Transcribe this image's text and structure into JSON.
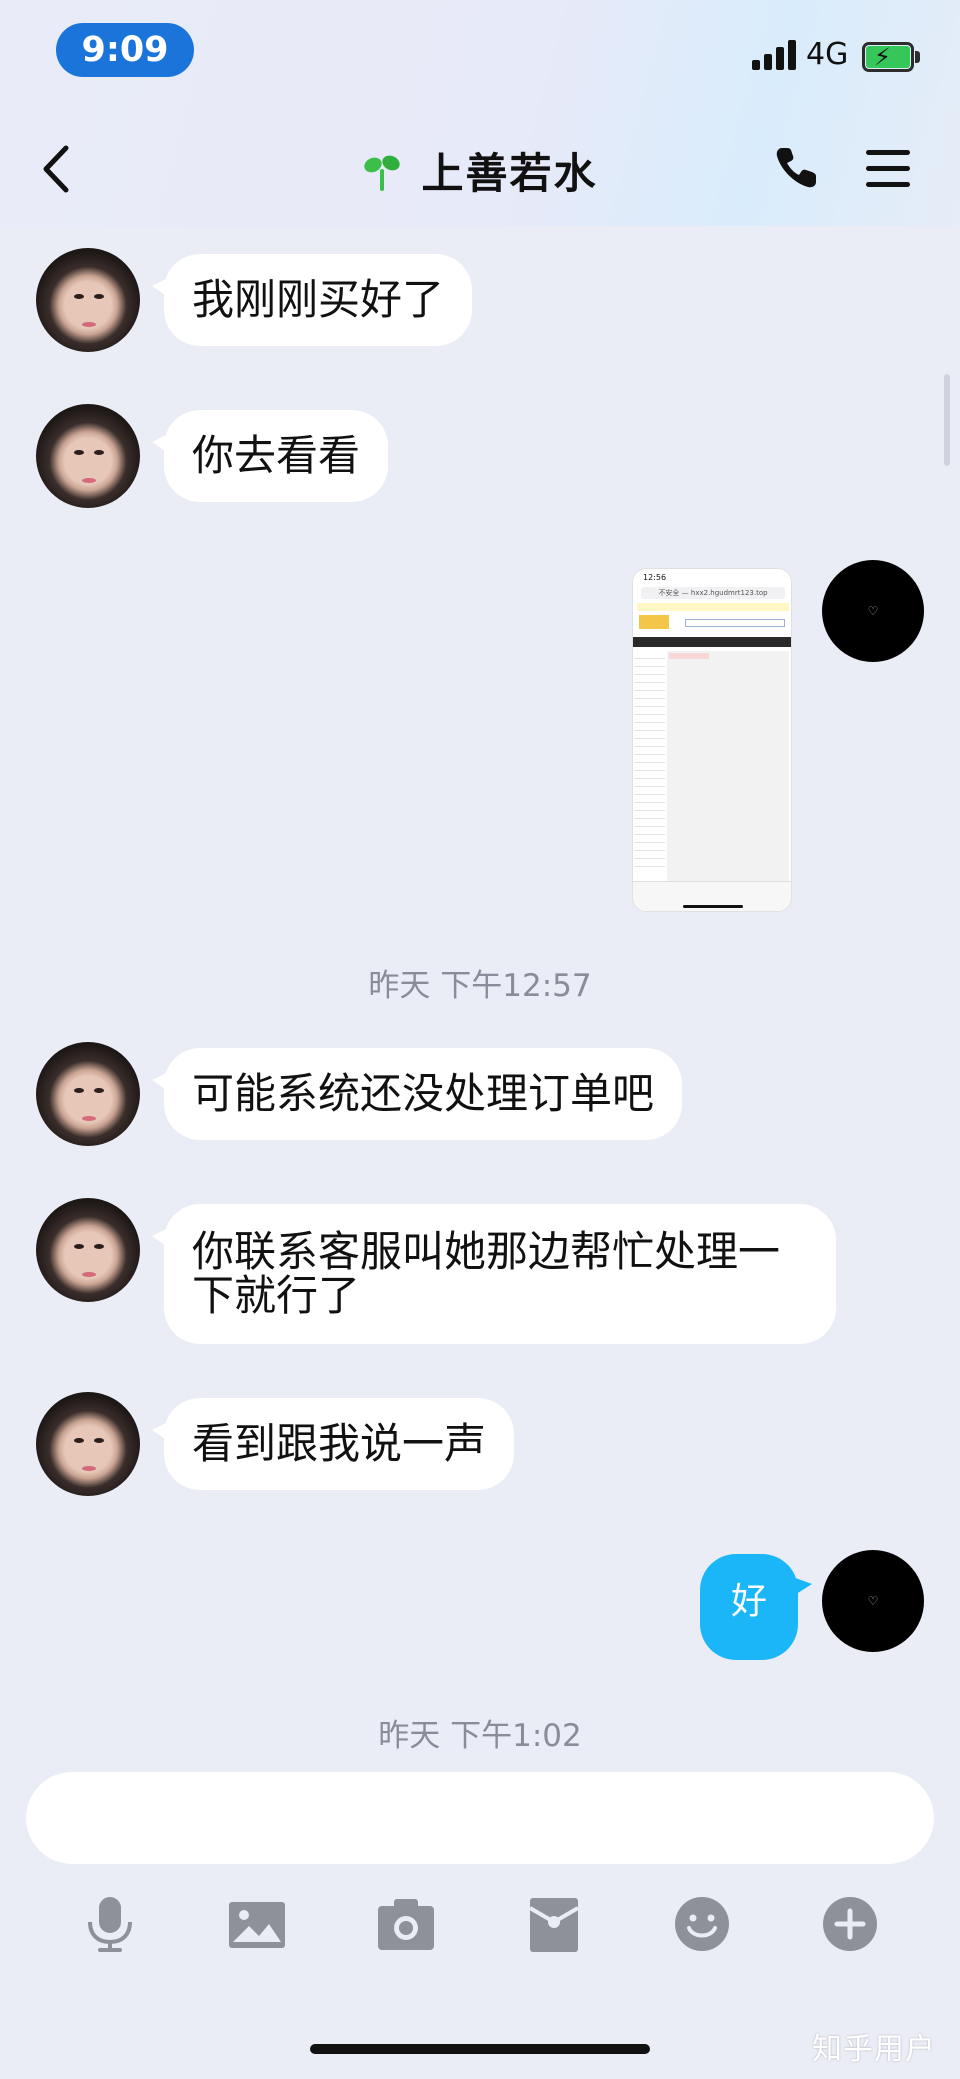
{
  "status_bar": {
    "time": "9:09",
    "network": "4G",
    "battery_charging": true,
    "battery_color": "#35c759",
    "time_pill_color": "#1b74d9"
  },
  "header": {
    "title": "上善若水",
    "title_icon": "sprout-icon",
    "back_icon": "back-chevron-icon",
    "call_icon": "phone-icon",
    "menu_icon": "menu-icon"
  },
  "messages": [
    {
      "side": "incoming",
      "type": "text",
      "text": "我刚刚买好了"
    },
    {
      "side": "incoming",
      "type": "text",
      "text": "你去看看"
    },
    {
      "side": "outgoing",
      "type": "image",
      "image": {
        "time": "12:56",
        "url": "不安全 — hxx2.hgudmrt123.top"
      }
    },
    {
      "type": "timestamp",
      "text": "昨天 下午12:57"
    },
    {
      "side": "incoming",
      "type": "text",
      "text": "可能系统还没处理订单吧"
    },
    {
      "side": "incoming",
      "type": "text",
      "text": "你联系客服叫她那边帮忙处理一下就行了"
    },
    {
      "side": "incoming",
      "type": "text",
      "text": "看到跟我说一声"
    },
    {
      "side": "outgoing",
      "type": "text",
      "text": "好"
    },
    {
      "type": "timestamp",
      "text": "昨天 下午1:02"
    }
  ],
  "composer": {
    "input_value": "",
    "tools": [
      "microphone-icon",
      "image-icon",
      "camera-icon",
      "red-packet-icon",
      "emoji-icon",
      "plus-icon"
    ]
  },
  "colors": {
    "background": "#eaecf6",
    "incoming_bubble": "#ffffff",
    "outgoing_bubble": "#1ab6f8",
    "timestamp_text": "#8a8d99",
    "toolbar_icon": "#8e9199"
  },
  "watermark": "知乎用户"
}
